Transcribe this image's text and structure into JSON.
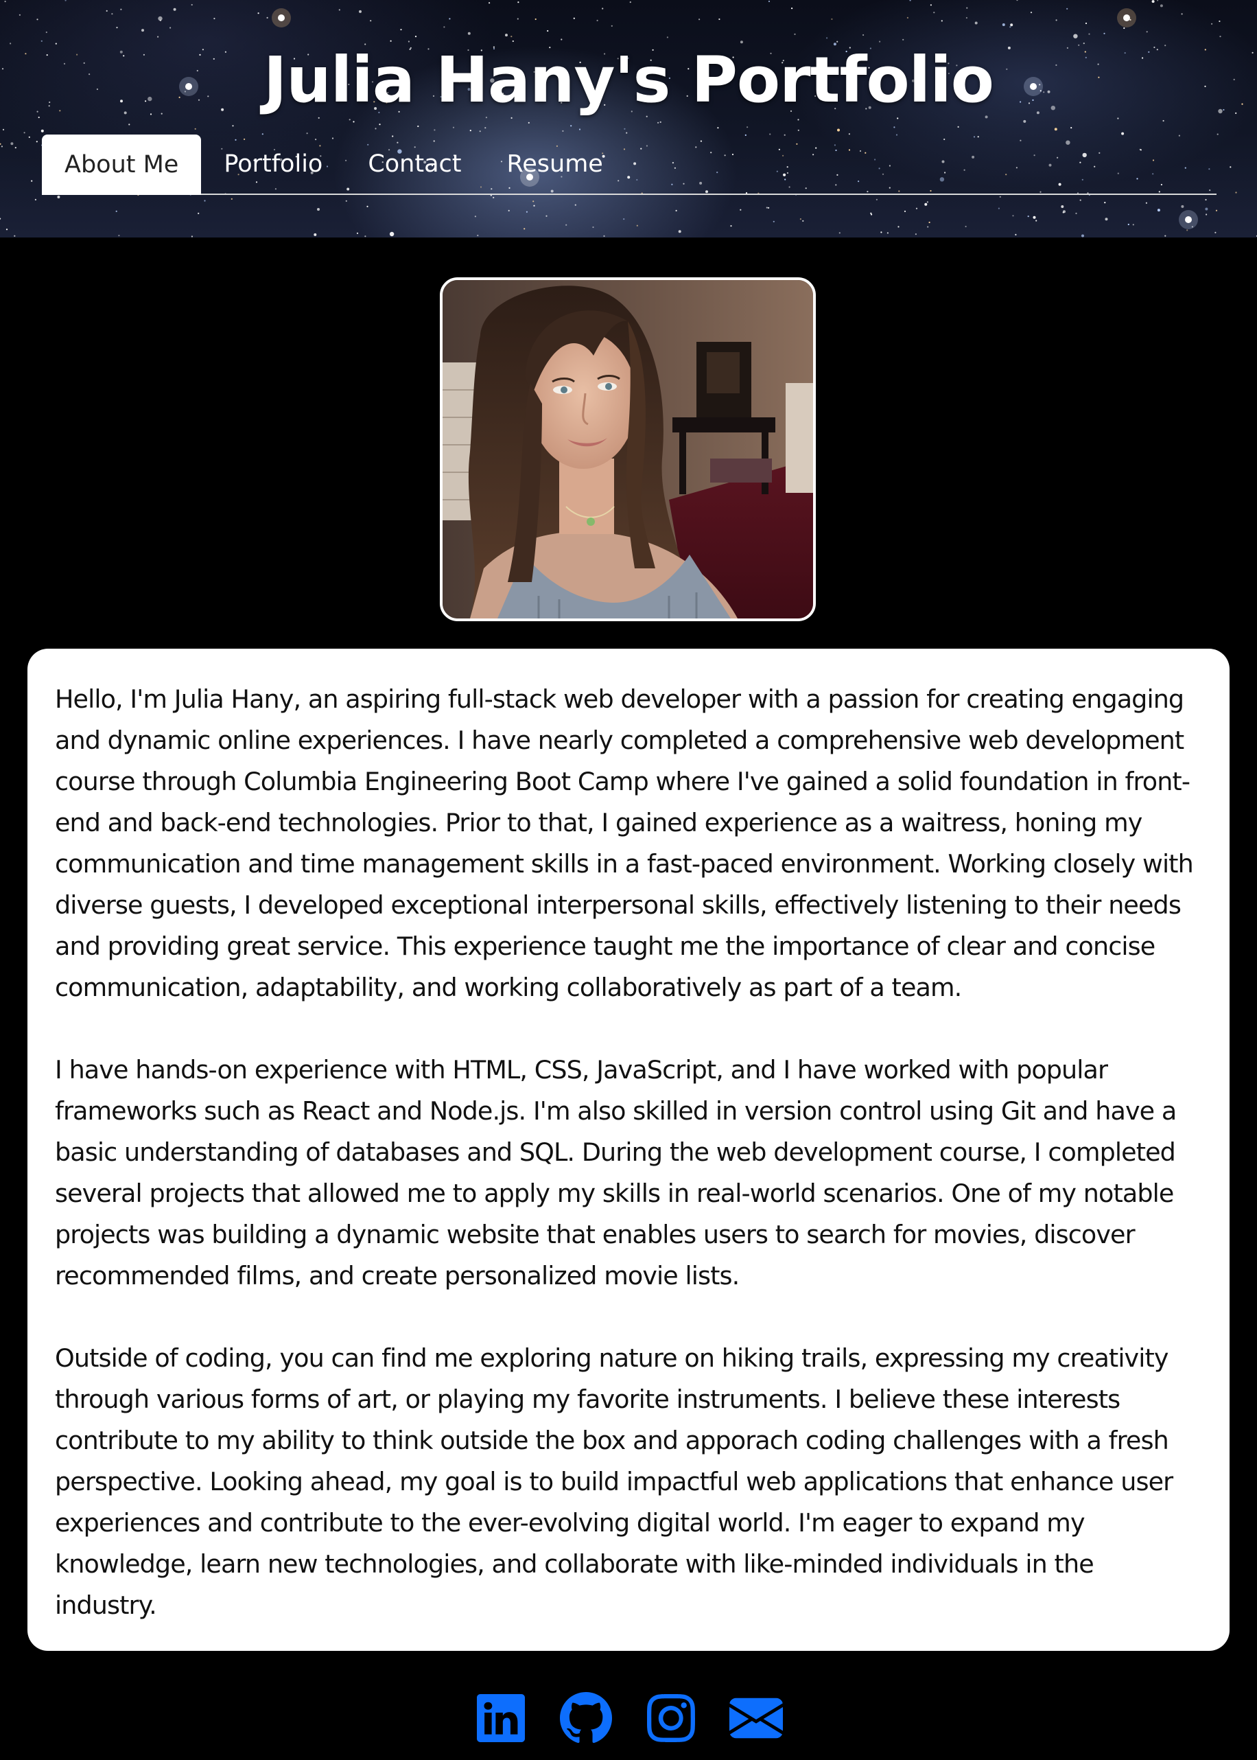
{
  "header": {
    "title": "Julia Hany's Portfolio"
  },
  "nav": {
    "tabs": [
      {
        "label": "About Me",
        "active": true
      },
      {
        "label": "Portfolio",
        "active": false
      },
      {
        "label": "Contact",
        "active": false
      },
      {
        "label": "Resume",
        "active": false
      }
    ]
  },
  "about": {
    "paragraphs": [
      "Hello, I'm Julia Hany, an aspiring full-stack web developer with a passion for creating engaging and dynamic online experiences. I have nearly completed a comprehensive web development course through Columbia Engineering Boot Camp where I've gained a solid foundation in front-end and back-end technologies. Prior to that, I gained experience as a waitress, honing my communication and time management skills in a fast-paced environment. Working closely with diverse guests, I developed exceptional interpersonal skills, effectively listening to their needs and providing great service. This experience taught me the importance of clear and concise communication, adaptability, and working collaboratively as part of a team.",
      "I have hands-on experience with HTML, CSS, JavaScript, and I have worked with popular frameworks such as React and Node.js. I'm also skilled in version control using Git and have a basic understanding of databases and SQL. During the web development course, I completed several projects that allowed me to apply my skills in real-world scenarios. One of my notable projects was building a dynamic website that enables users to search for movies, discover recommended films, and create personalized movie lists.",
      "Outside of coding, you can find me exploring nature on hiking trails, expressing my creativity through various forms of art, or playing my favorite instruments. I believe these interests contribute to my ability to think outside the box and apporach coding challenges with a fresh perspective. Looking ahead, my goal is to build impactful web applications that enhance user experiences and contribute to the ever-evolving digital world. I'm eager to expand my knowledge, learn new technologies, and collaborate with like-minded individuals in the industry."
    ]
  },
  "social": {
    "icons": [
      "linkedin-icon",
      "github-icon",
      "instagram-icon",
      "email-icon"
    ],
    "color": "#0d6efd"
  },
  "colors": {
    "page_background": "#000000",
    "card_background": "#ffffff",
    "nav_active_background": "#ffffff",
    "icon_blue": "#0d6efd"
  }
}
